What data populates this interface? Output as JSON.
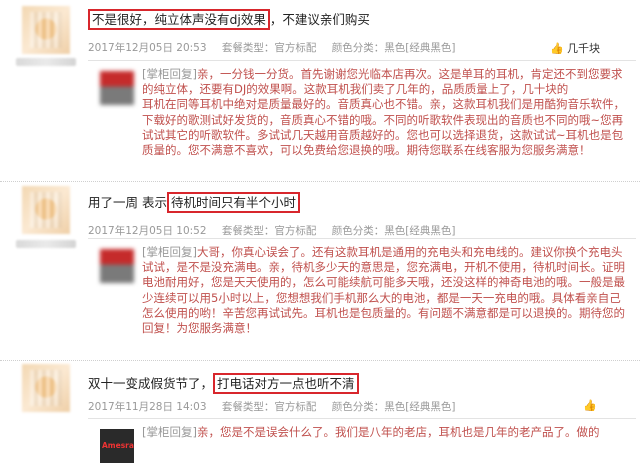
{
  "reviews": [
    {
      "pre": "",
      "highlight": "不是很好，纯立体声没有dj效果",
      "post": "，不建议亲们购买",
      "date": "2017年12月05日 20:53",
      "service_label": "套餐类型：官方标配",
      "color_label": "颜色分类：黑色[经典黑色]",
      "like_count": "几千块",
      "reply_tag": "[掌柜回复]",
      "reply_text": "亲，一分钱一分货。首先谢谢您光临本店再次。这是单耳的耳机，肯定还不到您要求的纯立体，还要有DJ的效果啊。这款耳机我们卖了几年的，品质质量上了，几十块的\n耳机在同等耳机中绝对是质量最好的。音质真心也不错。亲，这款耳机我们是用酷狗音乐软件，下载好的歌测试好发货的，音质真心不错的哦。不同的听歌软件表现出的音质也不同的哦~您再试试其它的听歌软件。多试试几天越用音质越好的。您也可以选择退货，这款试试~耳机也是包质量的。您不满意不喜欢，可以免费给您退换的哦。期待您联系在线客服为您服务满意！"
    },
    {
      "pre": "用了一周 表示",
      "highlight": "待机时间只有半个小时",
      "post": "",
      "date": "2017年12月05日 10:52",
      "service_label": "套餐类型：官方标配",
      "color_label": "颜色分类：黑色[经典黑色]",
      "like_count": "",
      "reply_tag": "[掌柜回复]",
      "reply_text": "大哥，你真心误会了。还有这款耳机是通用的充电头和充电线的。建议你换个充电头试试，是不是没充满电。亲，待机多少天的意思是，您充满电，开机不使用，待机时间长。证明电池耐用好，您是天天使用的，怎么可能续航可能多天哦，还没这样的神奇电池的哦。一般是最少连续可以用5小时以上，您想想我们手机那么大的电池，都是一天一充电的哦。具体看亲自己怎么使用的哟！辛苦您再试试先。耳机也是包质量的。有问题不满意都是可以退换的。期待您的回复！为您服务满意！"
    },
    {
      "pre": "双十一变成假货节了，",
      "highlight": "打电话对方一点也听不清",
      "post": "",
      "date": "2017年11月28日 14:03",
      "service_label": "套餐类型：官方标配",
      "color_label": "颜色分类：黑色[经典黑色]",
      "like_count": "",
      "reply_tag": "[掌柜回复]",
      "reply_text": "亲，您是不是误会什么了。我们是八年的老店，耳机也是几年的老产品了。做的",
      "seller_brand": "Amesra"
    }
  ]
}
